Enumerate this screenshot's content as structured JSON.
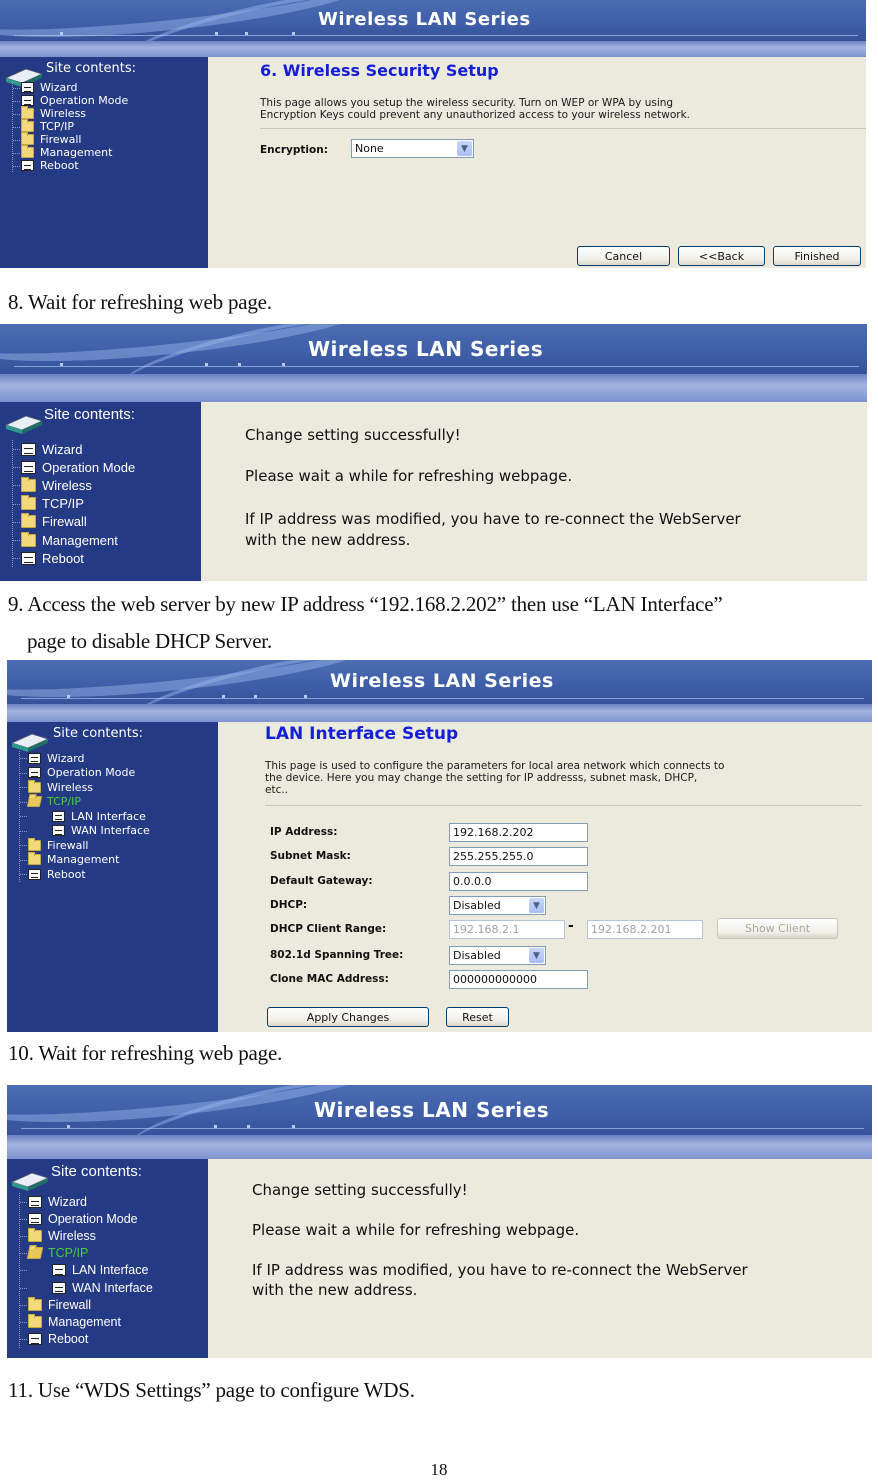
{
  "doc": {
    "steps": [
      {
        "text": "8. Wait for refreshing web page."
      },
      {
        "text": "9. Access the web server by new IP address “192.168.2.202” then use “LAN Interface”",
        "cont": "page to disable DHCP Server."
      },
      {
        "text": "10. Wait for refreshing web page."
      },
      {
        "text": "11. Use “WDS Settings” page to configure WDS."
      }
    ],
    "page_number": "18"
  },
  "app": {
    "banner_title": "Wireless LAN Series",
    "site_contents": "Site contents:",
    "accent_color": "#1420d6",
    "sidebar_color": "#253a84",
    "active_nav_color": "#43d13e"
  },
  "nav_basic": [
    {
      "label": "Wizard",
      "icon": "page-icon"
    },
    {
      "label": "Operation Mode",
      "icon": "page-icon"
    },
    {
      "label": "Wireless",
      "icon": "folder-icon"
    },
    {
      "label": "TCP/IP",
      "icon": "folder-icon"
    },
    {
      "label": "Firewall",
      "icon": "folder-icon"
    },
    {
      "label": "Management",
      "icon": "folder-icon"
    },
    {
      "label": "Reboot",
      "icon": "page-icon"
    }
  ],
  "nav_expanded": [
    {
      "label": "Wizard",
      "icon": "page-icon"
    },
    {
      "label": "Operation Mode",
      "icon": "page-icon"
    },
    {
      "label": "Wireless",
      "icon": "folder-icon"
    },
    {
      "label": "TCP/IP",
      "icon": "folder-open-icon",
      "active": true
    },
    {
      "label": "LAN Interface",
      "icon": "page-icon",
      "sub": true
    },
    {
      "label": "WAN Interface",
      "icon": "page-icon",
      "sub": true
    },
    {
      "label": "Firewall",
      "icon": "folder-icon"
    },
    {
      "label": "Management",
      "icon": "folder-icon"
    },
    {
      "label": "Reboot",
      "icon": "page-icon"
    }
  ],
  "shot1": {
    "title": "6. Wireless Security Setup",
    "desc_line1": "This page allows you setup the wireless security. Turn on WEP or WPA by using",
    "desc_line2": "Encryption Keys could prevent any unauthorized access to your wireless network.",
    "encryption_label": "Encryption:",
    "encryption_value": "None",
    "buttons": {
      "cancel": "Cancel",
      "back": "<<Back",
      "finished": "Finished"
    }
  },
  "refresh": {
    "line1": "Change setting successfully!",
    "line2": "Please wait a while for refreshing webpage.",
    "line3": "If IP address was modified, you have to re-connect the WebServer",
    "line4": "with the new address."
  },
  "shot3": {
    "title": "LAN Interface Setup",
    "desc_line1": "This page is used to configure the parameters for local area network which connects to",
    "desc_line2": "the device. Here you may change the setting for IP addresss, subnet mask, DHCP,",
    "desc_line3": "etc..",
    "fields": {
      "ip_label": "IP Address:",
      "ip_value": "192.168.2.202",
      "mask_label": "Subnet Mask:",
      "mask_value": "255.255.255.0",
      "gw_label": "Default Gateway:",
      "gw_value": "0.0.0.0",
      "dhcp_label": "DHCP:",
      "dhcp_value": "Disabled",
      "range_label": "DHCP Client Range:",
      "range_start": "192.168.2.1",
      "range_sep": "-",
      "range_end": "192.168.2.201",
      "show_client": "Show Client",
      "stp_label": "802.1d Spanning Tree:",
      "stp_value": "Disabled",
      "mac_label": "Clone MAC Address:",
      "mac_value": "000000000000"
    },
    "buttons": {
      "apply": "Apply Changes",
      "reset": "Reset"
    }
  }
}
